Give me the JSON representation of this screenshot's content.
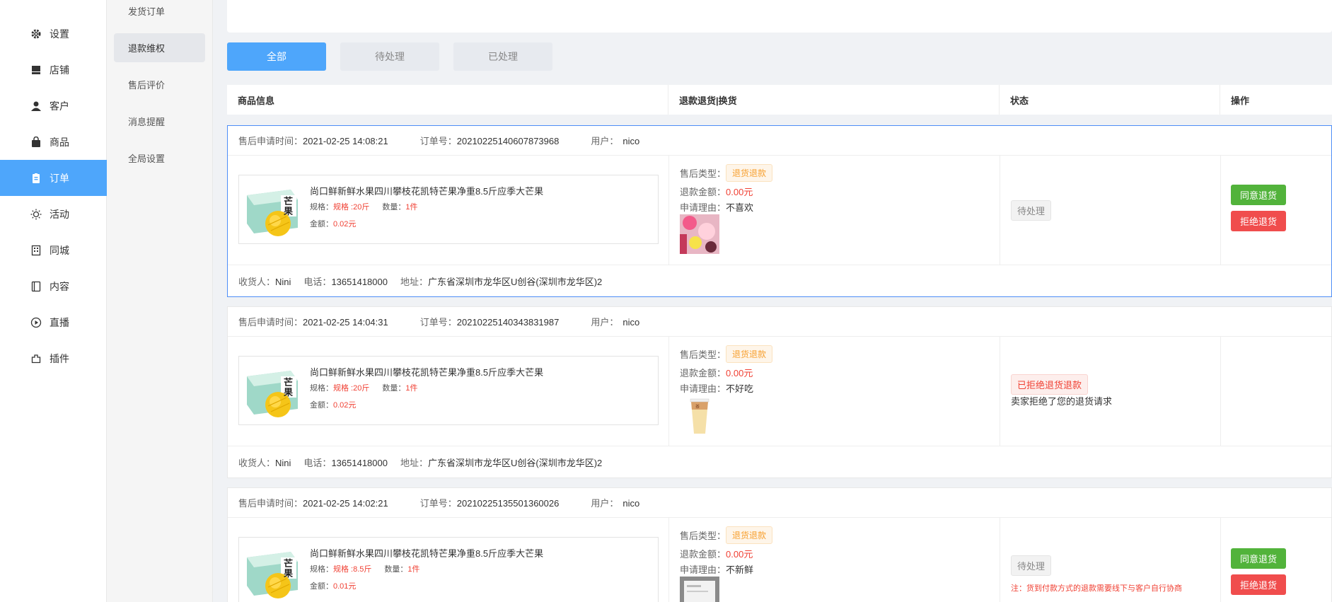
{
  "nav": {
    "items": [
      {
        "label": "设置",
        "icon": "gear-icon"
      },
      {
        "label": "店铺",
        "icon": "store-icon"
      },
      {
        "label": "客户",
        "icon": "user-icon"
      },
      {
        "label": "商品",
        "icon": "bag-icon"
      },
      {
        "label": "订单",
        "icon": "clipboard-icon"
      },
      {
        "label": "活动",
        "icon": "sun-icon"
      },
      {
        "label": "同城",
        "icon": "building-icon"
      },
      {
        "label": "内容",
        "icon": "book-icon"
      },
      {
        "label": "直播",
        "icon": "play-icon"
      },
      {
        "label": "插件",
        "icon": "plugin-icon"
      }
    ],
    "active": "订单"
  },
  "subnav": {
    "items": [
      "发货订单",
      "退款维权",
      "售后评价",
      "消息提醒",
      "全局设置"
    ],
    "active": "退款维权"
  },
  "tabs": [
    "全部",
    "待处理",
    "已处理"
  ],
  "table_headers": [
    "商品信息",
    "退款退货|换货",
    "状态",
    "操作"
  ],
  "labels": {
    "apply_time": "售后申请时间：",
    "order_no": "订单号：",
    "user": "用户：",
    "spec": "规格：",
    "qty": "数量：",
    "amount": "金额：",
    "after_type": "售后类型：",
    "refund_amount": "退款金额：",
    "reason": "申请理由：",
    "receiver": "收货人：",
    "phone": "电话：",
    "address": "地址："
  },
  "orders": [
    {
      "time": "2021-02-25 14:08:21",
      "order_no": "20210225140607873968",
      "user": "nico",
      "product_title": "尚口鲜新鲜水果四川攀枝花凯特芒果净重8.5斤应季大芒果",
      "thumb_text": "芒果",
      "spec": "规格 :20斤",
      "qty": "1件",
      "amount": "0.02元",
      "after_type": "退货退款",
      "refund_amount": "0.00元",
      "reason": "不喜欢",
      "status": "待处理",
      "status_note": "",
      "agree": "同意退货",
      "reject": "拒绝退货",
      "receiver": "Nini",
      "phone": "13651418000",
      "address": "广东省深圳市龙华区U创谷(深圳市龙华区)2"
    },
    {
      "time": "2021-02-25 14:04:31",
      "order_no": "20210225140343831987",
      "user": "nico",
      "product_title": "尚口鲜新鲜水果四川攀枝花凯特芒果净重8.5斤应季大芒果",
      "thumb_text": "芒果",
      "spec": "规格 :20斤",
      "qty": "1件",
      "amount": "0.02元",
      "after_type": "退货退款",
      "refund_amount": "0.00元",
      "reason": "不好吃",
      "status": "已拒绝退货退款",
      "status_note": "卖家拒绝了您的退货请求",
      "receiver": "Nini",
      "phone": "13651418000",
      "address": "广东省深圳市龙华区U创谷(深圳市龙华区)2"
    },
    {
      "time": "2021-02-25 14:02:21",
      "order_no": "20210225135501360026",
      "user": "nico",
      "product_title": "尚口鲜新鲜水果四川攀枝花凯特芒果净重8.5斤应季大芒果",
      "thumb_text": "芒果",
      "spec": "规格 :8.5斤",
      "qty": "1件",
      "amount": "0.01元",
      "after_type": "退货退款",
      "refund_amount": "0.00元",
      "reason": "不新鲜",
      "status": "待处理",
      "status_note": "注：货到付款方式的退款需要线下与客户自行协商",
      "agree": "同意退货",
      "reject": "拒绝退货"
    }
  ],
  "colors": {
    "primary": "#4ea6fb",
    "green": "#52b33b",
    "red": "#f04d4d",
    "orange": "#f7a030"
  }
}
